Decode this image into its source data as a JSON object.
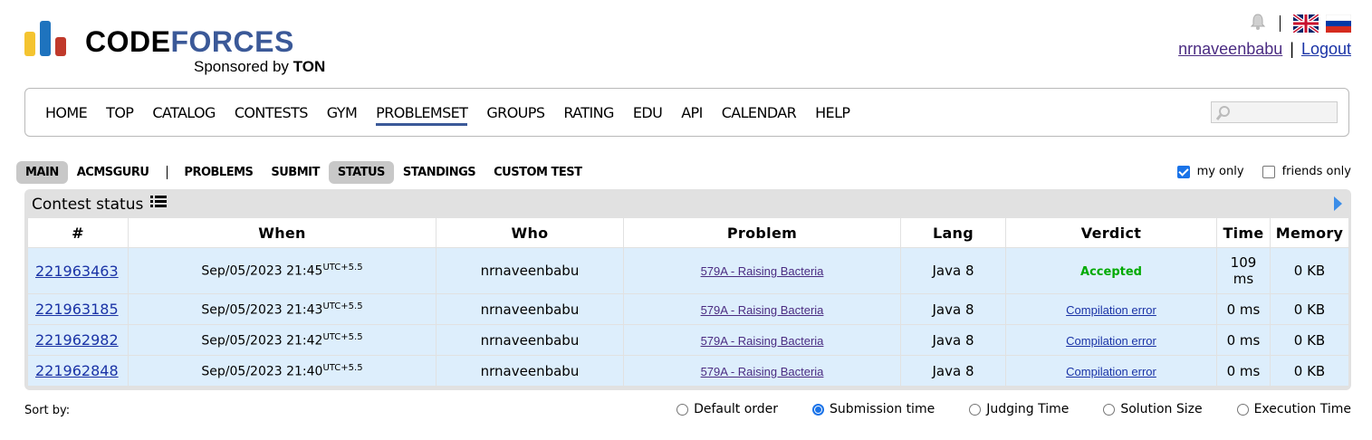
{
  "brand": {
    "logo_part1": "CODE",
    "logo_part2": "FORCES",
    "sponsor_prefix": "Sponsored by ",
    "sponsor_name": "TON",
    "colors": {
      "yellow": "#f4c430",
      "blue": "#1e73be",
      "red": "#c0392b",
      "accent": "#3b5998"
    }
  },
  "header": {
    "icons": [
      "bell-icon",
      "uk-flag-icon",
      "russia-flag-icon"
    ],
    "username": "nrnaveenbabu",
    "separator": "|",
    "logout": "Logout"
  },
  "menu": {
    "items": [
      "HOME",
      "TOP",
      "CATALOG",
      "CONTESTS",
      "GYM",
      "PROBLEMSET",
      "GROUPS",
      "RATING",
      "EDU",
      "API",
      "CALENDAR",
      "HELP"
    ],
    "active": "PROBLEMSET"
  },
  "subnav": {
    "main": "MAIN",
    "acmsguru": "ACMSGURU",
    "problems": "PROBLEMS",
    "submit": "SUBMIT",
    "status": "STATUS",
    "standings": "STANDINGS",
    "custom_test": "CUSTOM TEST",
    "selected": [
      "MAIN",
      "STATUS"
    ]
  },
  "filters": {
    "my_only": {
      "label": "my only",
      "checked": true
    },
    "friends_only": {
      "label": "friends only",
      "checked": false
    }
  },
  "status": {
    "title": "Contest status",
    "columns": [
      "#",
      "When",
      "Who",
      "Problem",
      "Lang",
      "Verdict",
      "Time",
      "Memory"
    ],
    "rows": [
      {
        "id": "221963463",
        "when": "Sep/05/2023 21:45",
        "tz": "UTC+5.5",
        "who": "nrnaveenbabu",
        "problem": "579A - Raising Bacteria",
        "lang": "Java 8",
        "verdict": "Accepted",
        "time": "109 ms",
        "memory": "0 KB"
      },
      {
        "id": "221963185",
        "when": "Sep/05/2023 21:43",
        "tz": "UTC+5.5",
        "who": "nrnaveenbabu",
        "problem": "579A - Raising Bacteria",
        "lang": "Java 8",
        "verdict": "Compilation error",
        "time": "0 ms",
        "memory": "0 KB"
      },
      {
        "id": "221962982",
        "when": "Sep/05/2023 21:42",
        "tz": "UTC+5.5",
        "who": "nrnaveenbabu",
        "problem": "579A - Raising Bacteria",
        "lang": "Java 8",
        "verdict": "Compilation error",
        "time": "0 ms",
        "memory": "0 KB"
      },
      {
        "id": "221962848",
        "when": "Sep/05/2023 21:40",
        "tz": "UTC+5.5",
        "who": "nrnaveenbabu",
        "problem": "579A - Raising Bacteria",
        "lang": "Java 8",
        "verdict": "Compilation error",
        "time": "0 ms",
        "memory": "0 KB"
      }
    ]
  },
  "sort": {
    "label": "Sort by:",
    "options": [
      {
        "label": "Default order",
        "selected": false
      },
      {
        "label": "Submission time",
        "selected": true
      },
      {
        "label": "Judging Time",
        "selected": false
      },
      {
        "label": "Solution Size",
        "selected": false
      },
      {
        "label": "Execution Time",
        "selected": false
      }
    ]
  }
}
